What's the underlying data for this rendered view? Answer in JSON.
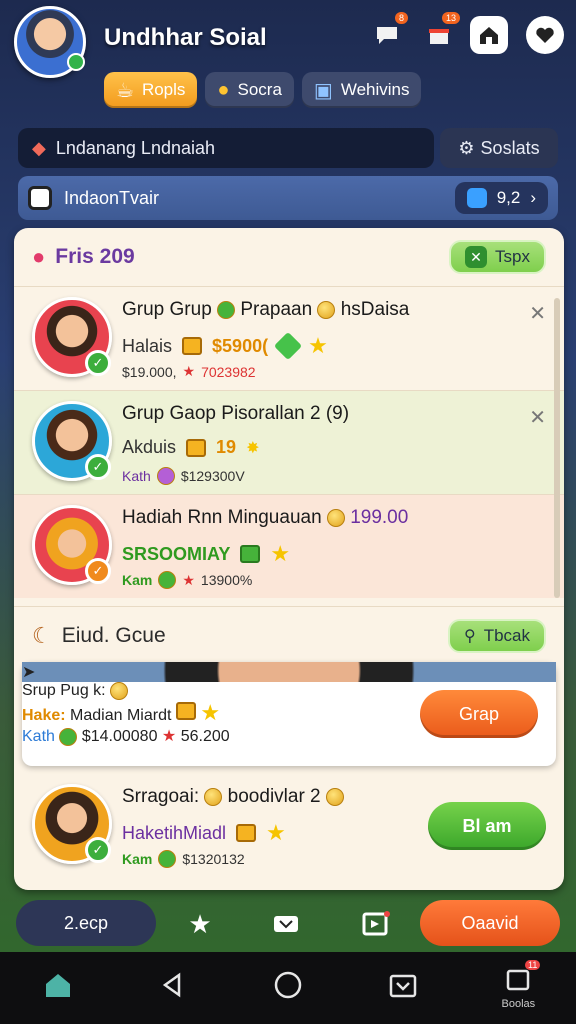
{
  "header": {
    "title": "Undhhar Soial",
    "icons": [
      {
        "name": "chat-icon",
        "badge": "8"
      },
      {
        "name": "gift-icon",
        "badge": "13"
      },
      {
        "name": "house-icon",
        "badge": ""
      },
      {
        "name": "heart-icon",
        "badge": ""
      }
    ],
    "tabs": [
      {
        "label": "Ropls",
        "icon": "cup-icon",
        "active": true
      },
      {
        "label": "Socra",
        "icon": "coin-stack-icon",
        "active": false
      },
      {
        "label": "Wehivins",
        "icon": "box-icon",
        "active": false
      }
    ]
  },
  "search": {
    "text": "Lndanang Lndnaiah",
    "settings_label": "Soslats"
  },
  "filter": {
    "label": "IndaonTvair",
    "stat": "9,2"
  },
  "sections": [
    {
      "title": "Fris 209",
      "button": "Tspx",
      "rows": [
        {
          "title": "Grup Grup",
          "title2": "Prapaan",
          "title3": "hsDaisa",
          "sub": "Halais",
          "reward": "$5900(",
          "meta1": "$19.000,",
          "meta2": "7023982",
          "closable": true
        },
        {
          "title": "Grup Gaop Pisorallan 2 (9)",
          "sub": "Akduis",
          "reward": "19",
          "meta1": "Kath",
          "meta2": "$129300V",
          "closable": true
        },
        {
          "title": "Hadiah Rnn Minguauan",
          "title2": "199.00",
          "sub": "SRSOOMIAY",
          "meta1": "Kam",
          "meta2": "13900%",
          "closable": false
        }
      ]
    },
    {
      "title": "Eiud. Gcue",
      "button": "Tbcak",
      "rows": [
        {
          "title": "Srup Pug k:",
          "sub_label": "Hake:",
          "sub": "Madian Miardt",
          "meta1": "Kath",
          "meta2": "$14.00080",
          "meta3": "56.200",
          "action": "Grap"
        },
        {
          "title": "Srragoai:",
          "title2": "boodivlar 2",
          "sub": "HaketihMiadl",
          "meta1": "Kam",
          "meta2": "$1320132",
          "action": "Bl am"
        }
      ]
    }
  ],
  "game_bar": {
    "left_label": "2.ecp",
    "right_label": "Oaavid"
  },
  "system_nav": {
    "recents_label": "Boolas",
    "recents_badge": "11"
  },
  "colors": {
    "accent_orange": "#f29a1d",
    "accent_green": "#3aa62a",
    "panel": "#fbf3e6"
  }
}
